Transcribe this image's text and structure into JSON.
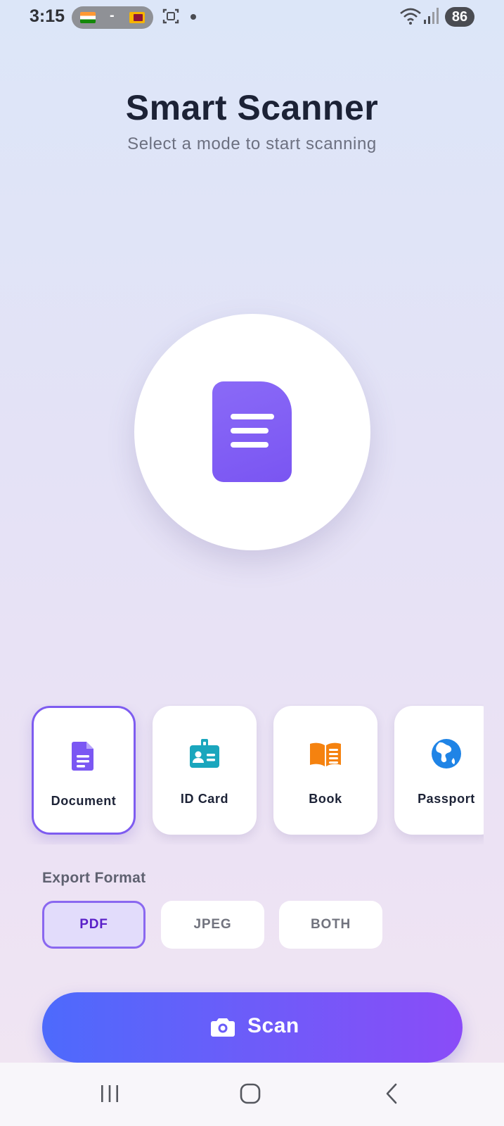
{
  "status_bar": {
    "time": "3:15",
    "flags_separator": "-",
    "battery": "86",
    "icons": [
      "india-flag-icon",
      "sri-lanka-flag-icon",
      "screenshot-icon",
      "wifi-icon",
      "signal-icon"
    ]
  },
  "header": {
    "title": "Smart Scanner",
    "subtitle": "Select a mode to start scanning"
  },
  "hero": {
    "icon": "document-icon",
    "accent": "#7b57f3"
  },
  "modes": [
    {
      "label": "Document",
      "icon": "document-icon",
      "color": "#7b57f3",
      "selected": true
    },
    {
      "label": "ID Card",
      "icon": "id-card-icon",
      "color": "#1aa6bd",
      "selected": false
    },
    {
      "label": "Book",
      "icon": "book-icon",
      "color": "#f5820f",
      "selected": false
    },
    {
      "label": "Passport",
      "icon": "globe-icon",
      "color": "#1f84e6",
      "selected": false
    }
  ],
  "export": {
    "label": "Export Format",
    "options": [
      {
        "label": "PDF",
        "selected": true
      },
      {
        "label": "JPEG",
        "selected": false
      },
      {
        "label": "BOTH",
        "selected": false
      }
    ]
  },
  "scan_button": {
    "label": "Scan",
    "icon": "camera-icon"
  },
  "nav_bar": {
    "icons": [
      "recent-apps-icon",
      "home-icon",
      "back-icon"
    ]
  }
}
